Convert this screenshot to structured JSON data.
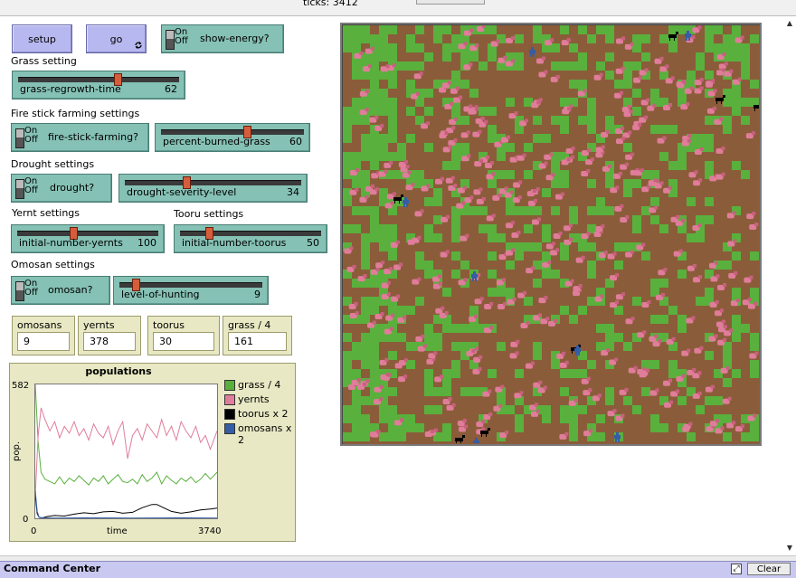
{
  "window": {
    "ticks_text": "ticks: 3412"
  },
  "buttons": {
    "setup": "setup",
    "go": "go",
    "go_icon": "forever-icon"
  },
  "sections": {
    "grass": "Grass setting",
    "firestick": "Fire stick farming settings",
    "drought": "Drought settings",
    "yernt": "Yernt settings",
    "tooru": "Tooru settings",
    "omosan": "Omosan settings"
  },
  "switch_text": {
    "on": "On",
    "off": "Off"
  },
  "switches": {
    "show_energy": "show-energy?",
    "fire_stick": "fire-stick-farming?",
    "drought": "drought?",
    "omosan": "omosan?"
  },
  "sliders": [
    {
      "id": "grass-regrowth-time",
      "name": "grass-regrowth-time",
      "value": "62",
      "fraction": 0.62
    },
    {
      "id": "percent-burned-grass",
      "name": "percent-burned-grass",
      "value": "60",
      "fraction": 0.6
    },
    {
      "id": "drought-severity-level",
      "name": "drought-severity-level",
      "value": "34",
      "fraction": 0.34
    },
    {
      "id": "initial-number-yernts",
      "name": "initial-number-yernts",
      "value": "100",
      "fraction": 0.39
    },
    {
      "id": "initial-number-toorus",
      "name": "initial-number-toorus",
      "value": "50",
      "fraction": 0.19
    },
    {
      "id": "level-of-hunting",
      "name": "level-of-hunting",
      "value": "9",
      "fraction": 0.09
    }
  ],
  "monitors": [
    {
      "label": "omosans",
      "value": "9"
    },
    {
      "label": "yernts",
      "value": "378"
    },
    {
      "label": "toorus",
      "value": "30"
    },
    {
      "label": "grass / 4",
      "value": "161"
    }
  ],
  "command_center": {
    "title": "Command Center",
    "clear": "Clear"
  },
  "colors": {
    "grass": "#59b03c",
    "yernts": "#e07d9a",
    "toorus": "#000000",
    "omosans": "#345da6",
    "patch": "#8b5c3a"
  },
  "chart_data": {
    "type": "line",
    "title": "populations",
    "xlabel": "time",
    "ylabel": "pop.",
    "xlim": [
      0,
      3740
    ],
    "ylim": [
      0,
      582
    ],
    "x_ticks": [
      "0",
      "3740"
    ],
    "y_ticks": [
      "0",
      "582"
    ],
    "legend_position": "right",
    "series": [
      {
        "name": "grass / 4",
        "color": "#59b03c",
        "x": [
          0,
          60,
          120,
          200,
          300,
          400,
          500,
          600,
          700,
          800,
          900,
          1000,
          1100,
          1200,
          1300,
          1400,
          1500,
          1600,
          1700,
          1800,
          1900,
          2000,
          2100,
          2200,
          2300,
          2400,
          2500,
          2600,
          2700,
          2800,
          2900,
          3000,
          3100,
          3200,
          3300,
          3400,
          3500,
          3600,
          3740
        ],
        "values": [
          582,
          330,
          200,
          170,
          160,
          150,
          180,
          150,
          175,
          160,
          185,
          165,
          145,
          175,
          160,
          185,
          150,
          170,
          190,
          160,
          155,
          170,
          150,
          190,
          160,
          175,
          200,
          150,
          185,
          165,
          150,
          175,
          160,
          180,
          155,
          170,
          195,
          170,
          200
        ]
      },
      {
        "name": "yernts",
        "color": "#e07d9a",
        "x": [
          0,
          60,
          120,
          200,
          300,
          400,
          500,
          600,
          700,
          800,
          900,
          1000,
          1100,
          1200,
          1300,
          1400,
          1500,
          1600,
          1700,
          1800,
          1900,
          2000,
          2100,
          2200,
          2300,
          2400,
          2500,
          2600,
          2700,
          2800,
          2900,
          3000,
          3100,
          3200,
          3300,
          3400,
          3500,
          3600,
          3740
        ],
        "values": [
          100,
          360,
          480,
          430,
          380,
          420,
          350,
          400,
          370,
          420,
          360,
          390,
          340,
          410,
          370,
          350,
          400,
          320,
          380,
          420,
          260,
          360,
          390,
          340,
          410,
          380,
          350,
          430,
          360,
          400,
          340,
          420,
          380,
          350,
          400,
          330,
          360,
          300,
          380
        ]
      },
      {
        "name": "toorus x 2",
        "color": "#000000",
        "x": [
          0,
          40,
          80,
          150,
          250,
          400,
          600,
          800,
          1000,
          1200,
          1400,
          1600,
          1800,
          2000,
          2200,
          2400,
          2500,
          2600,
          2800,
          3000,
          3200,
          3400,
          3600,
          3740
        ],
        "values": [
          100,
          20,
          4,
          2,
          8,
          12,
          10,
          18,
          24,
          20,
          28,
          30,
          22,
          26,
          46,
          60,
          60,
          50,
          30,
          22,
          28,
          36,
          40,
          44
        ]
      },
      {
        "name": "omosans x 2",
        "color": "#345da6",
        "x": [
          0,
          40,
          80,
          150,
          400,
          1000,
          2000,
          3000,
          3740
        ],
        "values": [
          120,
          30,
          4,
          2,
          1,
          2,
          1,
          2,
          1
        ]
      }
    ]
  }
}
